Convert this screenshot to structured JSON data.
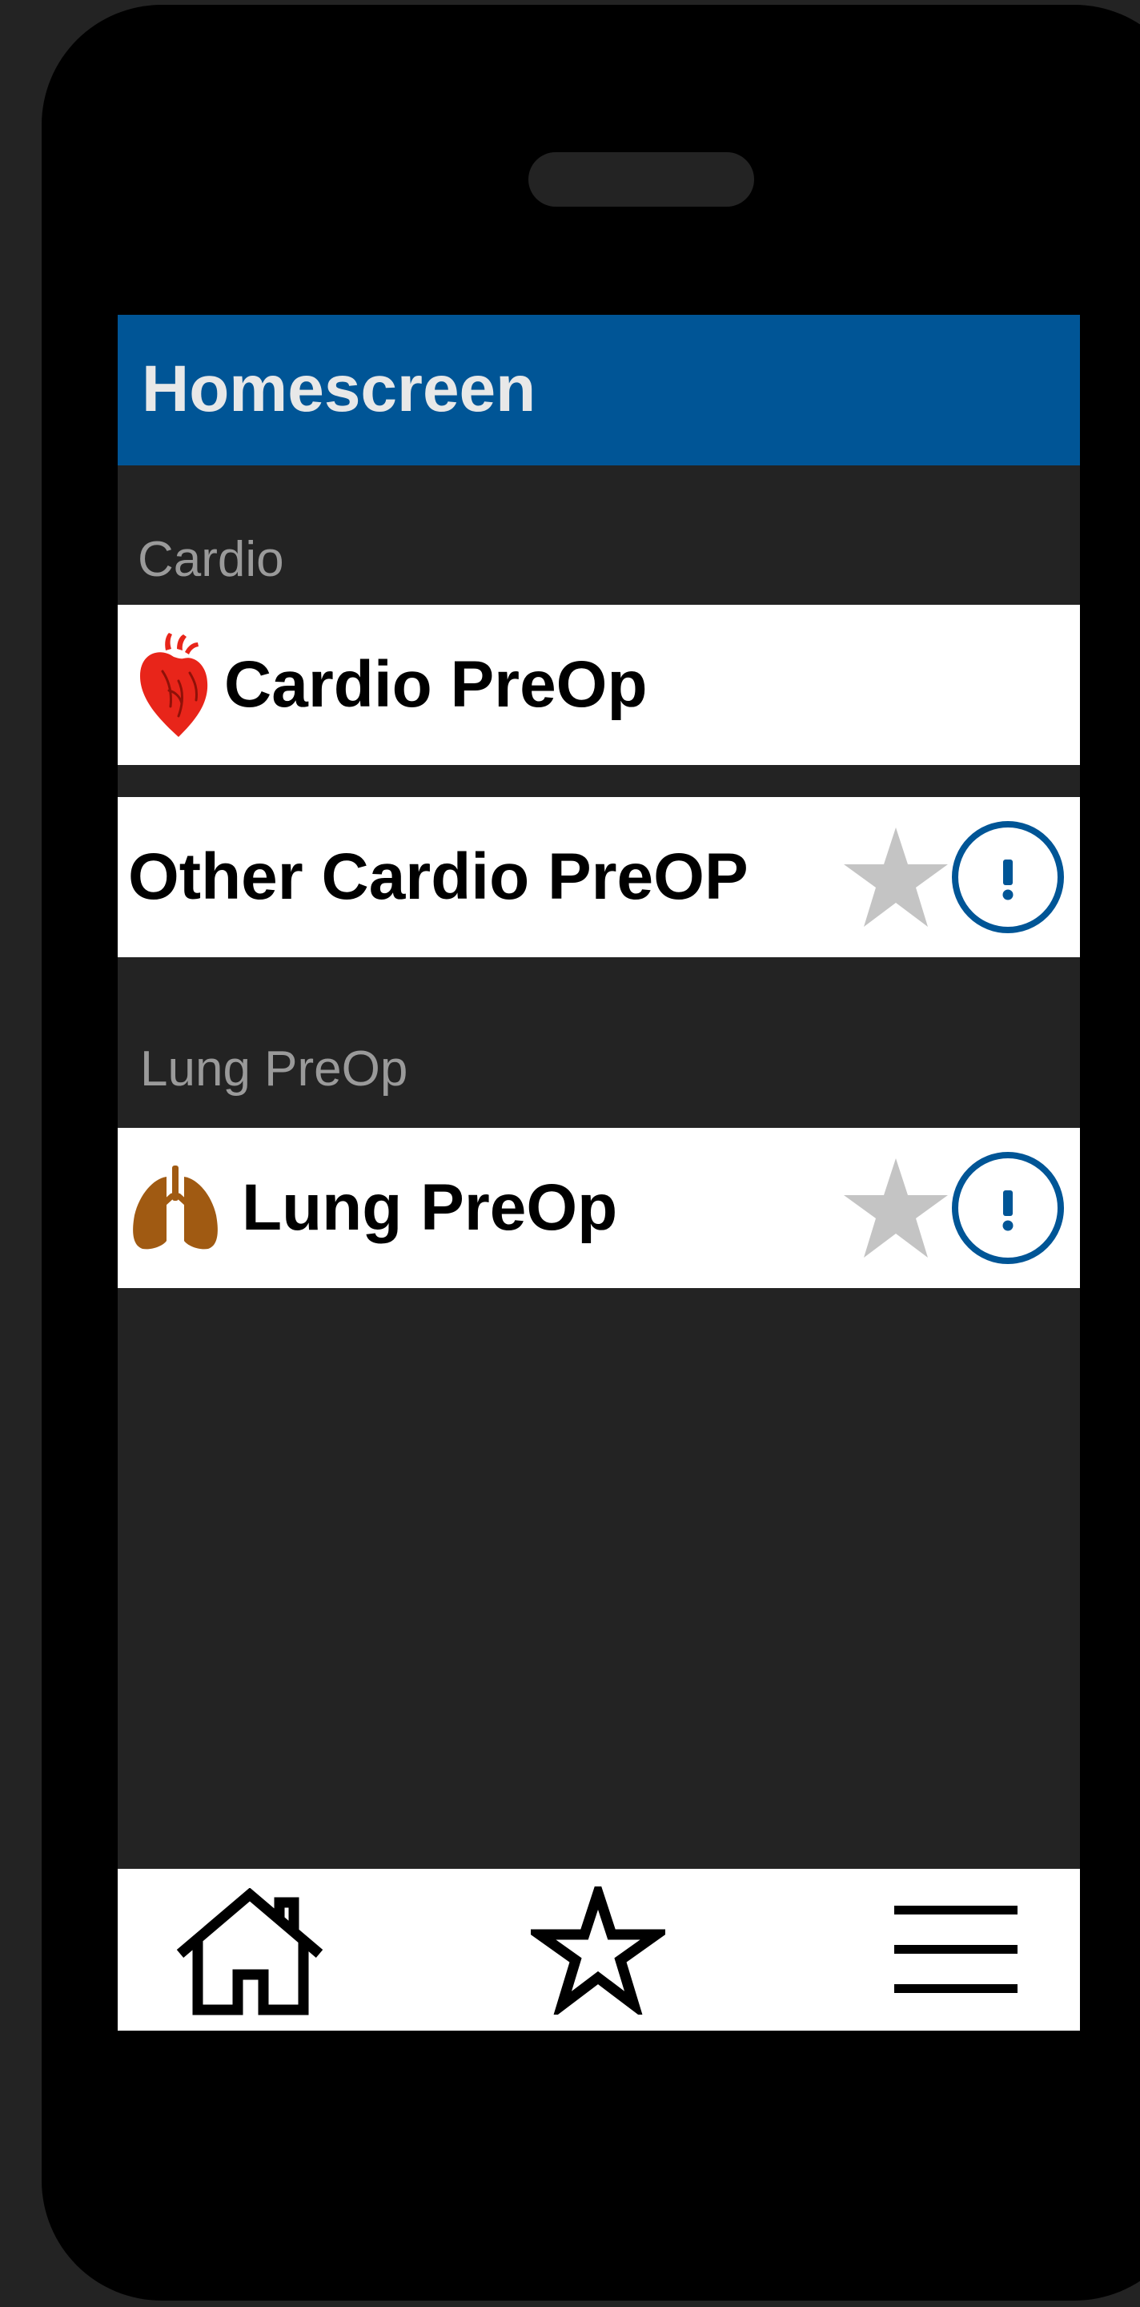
{
  "header": {
    "title": "Homescreen"
  },
  "sections": [
    {
      "label": "Cardio",
      "items": [
        {
          "label": "Cardio PreOp",
          "icon": "heart-icon",
          "icon_color": "#e8251a"
        },
        {
          "label": "Other Cardio PreOP",
          "icon": "",
          "star_icon": "star-icon",
          "info_icon": "info-icon"
        }
      ]
    },
    {
      "label": "Lung PreOp",
      "items": [
        {
          "label": "Lung PreOp",
          "icon": "lungs-icon",
          "icon_color": "#a05a12",
          "star_icon": "star-icon",
          "info_icon": "info-icon"
        }
      ]
    }
  ],
  "tabbar": {
    "tabs": [
      {
        "icon": "home-icon"
      },
      {
        "icon": "star-outline-icon"
      },
      {
        "icon": "hamburger-menu-icon"
      }
    ]
  },
  "colors": {
    "header_bg": "#005596",
    "screen_bg": "#232323",
    "phone_body": "#000000",
    "star_inactive": "#c4c4c4",
    "info_accent": "#005596"
  }
}
